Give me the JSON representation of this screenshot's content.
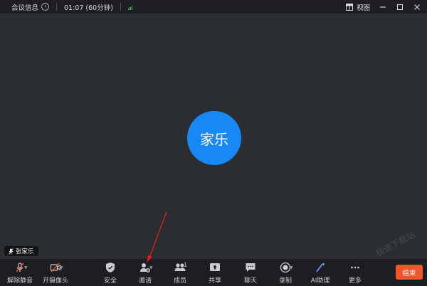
{
  "titlebar": {
    "meeting_info": "会议信息",
    "info_icon": "info-icon",
    "duration": "01:07 (60分钟)",
    "signal_icon": "signal-icon",
    "view_label": "视图"
  },
  "stage": {
    "avatar_text": "家乐",
    "participant_name": "张家乐",
    "watermark": "极速下载站"
  },
  "toolbar": {
    "unmute": "解除静音",
    "camera": "开摄像头",
    "security": "安全",
    "invite": "邀请",
    "members": "成员",
    "member_count": "1",
    "share": "共享",
    "chat": "聊天",
    "record": "录制",
    "ai": "AI助理",
    "more": "更多",
    "end": "结束"
  },
  "colors": {
    "accent_blue": "#1888f5",
    "end_red": "#f2542d",
    "signal_green": "#2fbf5b",
    "annotation_red": "#e02020"
  }
}
